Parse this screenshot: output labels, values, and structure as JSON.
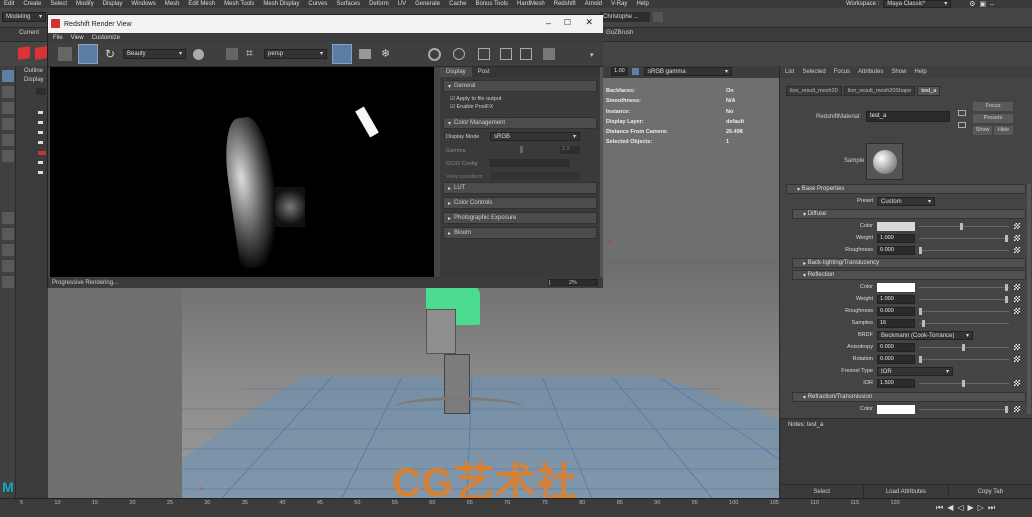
{
  "maya": {
    "menus": [
      "Edit",
      "Create",
      "Select",
      "Modify",
      "Display",
      "Windows",
      "Mesh",
      "Edit Mesh",
      "Mesh Tools",
      "Mesh Display",
      "Curves",
      "Surfaces",
      "Deform",
      "UV",
      "Generate",
      "Cache",
      "Bonus Tools",
      "HardMesh",
      "Redshift",
      "Arnold",
      "V-Ray",
      "Help"
    ],
    "workspace_label": "Workspace :",
    "workspace_value": "Maya Classic*",
    "mode": "Modeling",
    "user": "Christophe ...",
    "shelf_label": "Current",
    "shelf_tab_go": "GoZBrush",
    "outliner_label": "Outline",
    "display_label": "Display",
    "sv_value": "1.00",
    "color_space": "sRGB gamma"
  },
  "render_view": {
    "title": "Redshift Render View",
    "menus": [
      "File",
      "View",
      "Customize"
    ],
    "beauty": "Beauty",
    "camera": "persp",
    "panel_tabs": [
      "Display",
      "Post"
    ],
    "sections": {
      "general": "General",
      "apply_to_file_output": "Apply to file output",
      "enable_postfx": "Enable PostFX",
      "color_management": "Color Management",
      "display_mode_label": "Display Mode",
      "display_mode_value": "sRGB",
      "gamma_label": "Gamma",
      "gamma_value": "2.2",
      "ocio_label": "OCIO Config",
      "view_transform_label": "View transform",
      "lut": "LUT",
      "color_controls": "Color Controls",
      "photo_exposure": "Photographic Exposure",
      "bloom": "Bloom"
    },
    "status": "Progressive Rendering...",
    "progress_text": "2%",
    "progress": 0.02
  },
  "hud": {
    "labels": [
      "Backfaces:",
      "Smoothness:",
      "Instance:",
      "Display Layer:",
      "Distance From Camera:",
      "Selected Objects:"
    ],
    "values": [
      "On",
      "N/A",
      "No",
      "default",
      "26.498",
      "1"
    ]
  },
  "attribute_editor": {
    "menus": [
      "List",
      "Selected",
      "Focus",
      "Attributes",
      "Show",
      "Help"
    ],
    "tabs": [
      "lion_result_mesh20",
      "lion_result_mesh20Shape",
      "test_a"
    ],
    "material_label": "RedshiftMaterial:",
    "material_name": "test_a",
    "focus": "Focus",
    "presets": "Presets",
    "show": "Show",
    "hide": "Hide",
    "sample_label": "Sample",
    "base_properties": "Base Properties",
    "preset_label": "Preset",
    "preset_value": "Custom",
    "diffuse": "Diffuse",
    "d_color": "Color",
    "d_weight_label": "Weight",
    "d_weight": "1.000",
    "d_rough_label": "Roughness",
    "d_rough": "0.000",
    "backlighting": "Back-lighting/Translucency",
    "reflection": "Reflection",
    "r_color": "Color",
    "r_weight_label": "Weight",
    "r_weight": "1.000",
    "r_rough_label": "Roughness",
    "r_rough": "0.000",
    "samples_label": "Samples",
    "samples": "16",
    "brdf_label": "BRDF",
    "brdf": "Beckmann (Cook-Torrance)",
    "aniso_label": "Anisotropy",
    "aniso": "0.000",
    "rotation_label": "Rotation",
    "rotation": "0.000",
    "fresnel_label": "Fresnel Type",
    "fresnel": "IOR",
    "ior_label": "IOR",
    "ior": "1.500",
    "refraction": "Refraction/Transmission",
    "rt_color": "Color",
    "notes": "Notes: test_a",
    "select": "Select",
    "load_attributes": "Load Attributes",
    "copy_tab": "Copy Tab"
  },
  "timeline": {
    "ticks": [
      "5",
      "10",
      "15",
      "20",
      "25",
      "30",
      "35",
      "40",
      "45",
      "50",
      "55",
      "60",
      "65",
      "70",
      "75",
      "80",
      "85",
      "90",
      "95",
      "100",
      "105",
      "110",
      "115",
      "120"
    ]
  },
  "watermark": "CG艺术社"
}
